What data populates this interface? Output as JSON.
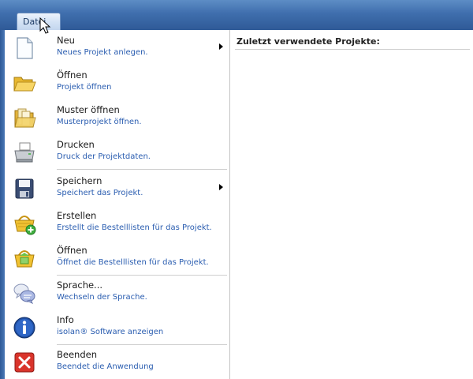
{
  "file_tab": {
    "label": "Datei"
  },
  "recent": {
    "title": "Zuletzt verwendete Projekte:"
  },
  "menu": {
    "items": [
      {
        "title": "Neu",
        "desc": "Neues Projekt anlegen.",
        "icon": "new-document-icon",
        "submenu": true
      },
      {
        "title": "Öffnen",
        "desc": "Projekt öffnen",
        "icon": "folder-open-icon",
        "submenu": false
      },
      {
        "title": "Muster öffnen",
        "desc": "Musterprojekt öffnen.",
        "icon": "sample-folder-icon",
        "submenu": false
      },
      {
        "title": "Drucken",
        "desc": "Druck der Projektdaten.",
        "icon": "printer-icon",
        "submenu": false
      },
      {
        "title": "Speichern",
        "desc": "Speichert das Projekt.",
        "icon": "floppy-disk-icon",
        "submenu": true
      },
      {
        "title": "Erstellen",
        "desc": "Erstellt die Bestelllisten für das Projekt.",
        "icon": "create-basket-icon",
        "submenu": false
      },
      {
        "title": "Öffnen",
        "desc": "Öffnet die Bestelllisten für das Projekt.",
        "icon": "open-basket-icon",
        "submenu": false
      },
      {
        "title": "Sprache...",
        "desc": "Wechseln der Sprache.",
        "icon": "speech-bubbles-icon",
        "submenu": false
      },
      {
        "title": "Info",
        "desc": "isolan® Software anzeigen",
        "icon": "info-icon",
        "submenu": false
      },
      {
        "title": "Beenden",
        "desc": "Beendet die Anwendung",
        "icon": "exit-icon",
        "submenu": false
      }
    ]
  }
}
